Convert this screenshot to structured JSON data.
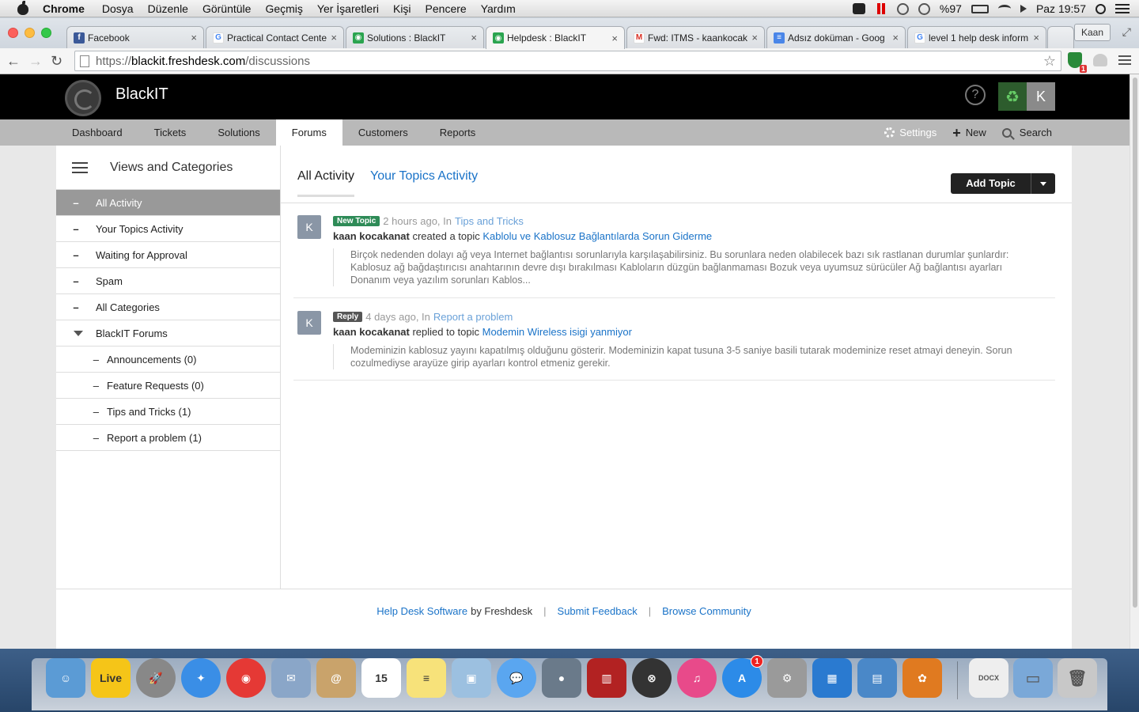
{
  "menubar": {
    "app": "Chrome",
    "items": [
      "Dosya",
      "Düzenle",
      "Görüntüle",
      "Geçmiş",
      "Yer İşaretleri",
      "Kişi",
      "Pencere",
      "Yardım"
    ],
    "battery": "%97",
    "clock": "Paz 19:57"
  },
  "browser": {
    "tabs": [
      {
        "title": "Facebook",
        "icon": "facebook-icon",
        "color": "#3b5998",
        "glyph": "f"
      },
      {
        "title": "Practical Contact Cente",
        "icon": "google-icon",
        "color": "#ffffff",
        "glyph": "G"
      },
      {
        "title": "Solutions : BlackIT",
        "icon": "freshdesk-icon",
        "color": "#2aa44f",
        "glyph": "◉"
      },
      {
        "title": "Helpdesk : BlackIT",
        "icon": "freshdesk-icon",
        "color": "#2aa44f",
        "glyph": "◉"
      },
      {
        "title": "Fwd: ITMS - kaankocak",
        "icon": "gmail-icon",
        "color": "#ffffff",
        "glyph": "M"
      },
      {
        "title": "Adsız doküman - Goog",
        "icon": "google-docs-icon",
        "color": "#4a86e8",
        "glyph": "≡"
      },
      {
        "title": "level 1 help desk inform",
        "icon": "google-icon",
        "color": "#ffffff",
        "glyph": "G"
      }
    ],
    "active_tab": 3,
    "profile": "Kaan",
    "url": {
      "scheme": "https://",
      "host": "blackit.freshdesk.com",
      "path": "/discussions"
    }
  },
  "freshdesk": {
    "brand": "BlackIT",
    "help": "?",
    "avatar_letter": "K",
    "nav": [
      "Dashboard",
      "Tickets",
      "Solutions",
      "Forums",
      "Customers",
      "Reports"
    ],
    "nav_active": "Forums",
    "nav_right": {
      "settings": "Settings",
      "new": "New",
      "search": "Search"
    },
    "sidebar": {
      "title": "Views and Categories",
      "items": [
        {
          "label": "All Activity"
        },
        {
          "label": "Your Topics Activity"
        },
        {
          "label": "Waiting for Approval"
        },
        {
          "label": "Spam"
        },
        {
          "label": "All Categories"
        }
      ],
      "group": "BlackIT Forums",
      "forums": [
        {
          "label": "Announcements (0)"
        },
        {
          "label": "Feature Requests (0)"
        },
        {
          "label": "Tips and Tricks (1)"
        },
        {
          "label": "Report a problem (1)"
        }
      ]
    },
    "main": {
      "tabs": [
        "All Activity",
        "Your Topics Activity"
      ],
      "add_topic": "Add Topic",
      "activities": [
        {
          "avatar": "K",
          "badge": "New Topic",
          "time": "2 hours ago, In",
          "forum": "Tips and Tricks",
          "user": "kaan kocakanat",
          "action": "created a topic",
          "topic": "Kablolu ve Kablosuz Bağlantılarda Sorun Giderme",
          "excerpt": "Birçok nedenden dolayı ağ veya Internet bağlantısı sorunlarıyla karşılaşabilirsiniz. Bu sorunlara neden olabilecek bazı sık rastlanan durumlar şunlardır: Kablosuz ağ bağdaştırıcısı anahtarının devre dışı bırakılması Kabloların düzgün bağlanmaması Bozuk veya uyumsuz sürücüler Ağ bağlantısı ayarları Donanım veya yazılım sorunları Kablos..."
        },
        {
          "avatar": "K",
          "badge": "Reply",
          "time": "4 days ago, In",
          "forum": "Report a problem",
          "user": "kaan kocakanat",
          "action": "replied to topic",
          "topic": "Modemin Wireless isigi yanmiyor",
          "excerpt": "Modeminizin kablosuz yayını kapatılmış olduğunu gösterir. Modeminizin kapat tusuna 3-5 saniye basili tutarak modeminize reset atmayi deneyin. Sorun cozulmediyse arayüze girip ayarları kontrol etmeniz gerekir."
        }
      ]
    },
    "footer": {
      "link1": "Help Desk Software",
      "by": "by Freshdesk",
      "link2": "Submit Feedback",
      "link3": "Browse Community"
    }
  },
  "dock": {
    "items": [
      {
        "name": "finder-icon",
        "color": "#5b9bd5",
        "glyph": "☺"
      },
      {
        "name": "live-icon",
        "color": "#f5c518",
        "glyph": "Live"
      },
      {
        "name": "launchpad-icon",
        "color": "#888888",
        "glyph": "🚀"
      },
      {
        "name": "safari-icon",
        "color": "#3a8ee6",
        "glyph": "✦"
      },
      {
        "name": "chrome-icon",
        "color": "#e53935",
        "glyph": "◉"
      },
      {
        "name": "mail-icon",
        "color": "#8aa6c8",
        "glyph": "✉"
      },
      {
        "name": "contacts-icon",
        "color": "#c9a36b",
        "glyph": "@"
      },
      {
        "name": "calendar-icon",
        "color": "#ffffff",
        "glyph": "15"
      },
      {
        "name": "notes-icon",
        "color": "#f7e27a",
        "glyph": "≡"
      },
      {
        "name": "preview-icon",
        "color": "#9cc0e0",
        "glyph": "▣"
      },
      {
        "name": "messages-icon",
        "color": "#5aa6f0",
        "glyph": "💬"
      },
      {
        "name": "facetime-icon",
        "color": "#6a7a8a",
        "glyph": "●"
      },
      {
        "name": "photo-booth-icon",
        "color": "#b22222",
        "glyph": "▥"
      },
      {
        "name": "app-switch-icon",
        "color": "#333333",
        "glyph": "⊗"
      },
      {
        "name": "itunes-icon",
        "color": "#e84a8a",
        "glyph": "♫"
      },
      {
        "name": "app-store-icon",
        "color": "#2c8be8",
        "glyph": "A",
        "badge": "1"
      },
      {
        "name": "system-preferences-icon",
        "color": "#9a9a9a",
        "glyph": "⚙"
      },
      {
        "name": "remote-desktop-icon",
        "color": "#2a7ad0",
        "glyph": "▦"
      },
      {
        "name": "virtual-machine-icon",
        "color": "#4a88c8",
        "glyph": "▤"
      },
      {
        "name": "fl-studio-icon",
        "color": "#e07a20",
        "glyph": "✿"
      }
    ],
    "right": [
      {
        "name": "docx-file-icon",
        "color": "#eeeeee",
        "glyph": "DOCX"
      },
      {
        "name": "folder-icon",
        "color": "#7aa8d8",
        "glyph": "▭"
      },
      {
        "name": "trash-icon",
        "color": "#c8c8c8",
        "glyph": "🗑"
      }
    ]
  }
}
